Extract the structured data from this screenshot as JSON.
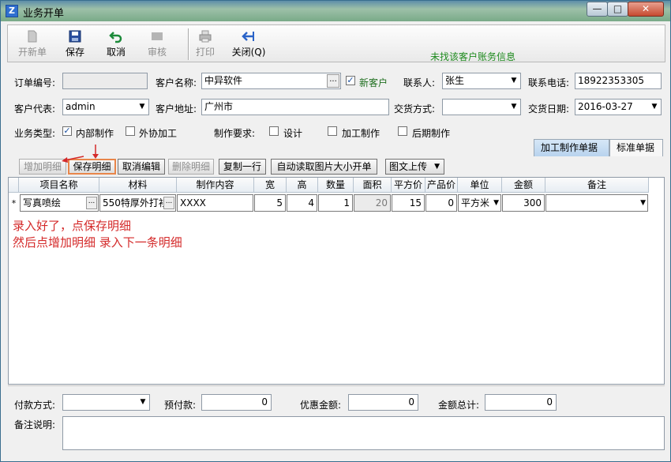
{
  "window": {
    "title": "业务开单",
    "min": "0",
    "max": "1",
    "close": "r"
  },
  "toolbar": {
    "new_label": "开新单",
    "save_label": "保存",
    "cancel_label": "取消",
    "audit_label": "审核",
    "print_label": "打印",
    "close_label": "关闭(Q)",
    "notice": "未找该客户账务信息"
  },
  "form": {
    "order_no_label": "订单编号:",
    "order_no_value": "",
    "customer_name_label": "客户名称:",
    "customer_name_value": "中异软件",
    "new_customer_label": "新客户",
    "contact_label": "联系人:",
    "contact_value": "张生",
    "phone_label": "联系电话:",
    "phone_value": "18922353305",
    "rep_label": "客户代表:",
    "rep_value": "admin",
    "address_label": "客户地址:",
    "address_value": "广州市",
    "delivery_label": "交货方式:",
    "delivery_value": "",
    "date_label": "交货日期:",
    "date_value": "2016-03-27",
    "biz_type_label": "业务类型:",
    "internal_label": "内部制作",
    "outsource_label": "外协加工",
    "req_label": "制作要求:",
    "design_label": "设计",
    "process_label": "加工制作",
    "post_label": "后期制作"
  },
  "tabs": {
    "processing": "加工制作单据",
    "standard": "标准单据"
  },
  "detail_buttons": {
    "add": "增加明细",
    "save": "保存明细",
    "cancel_edit": "取消编辑",
    "delete": "删除明细",
    "copy_row": "复制一行",
    "auto_read": "自动读取图片大小开单",
    "upload": "图文上传"
  },
  "grid": {
    "headers": [
      "项目名称",
      "材料",
      "制作内容",
      "宽",
      "高",
      "数量",
      "面积",
      "平方价",
      "产品价",
      "单位",
      "金额",
      "备注"
    ],
    "row_marker": "*",
    "row": [
      "写真喷绘",
      "550特厚外打衫",
      "XXXX",
      "5",
      "4",
      "1",
      "20",
      "15",
      "0",
      "平方米",
      "300",
      ""
    ]
  },
  "notes": {
    "line1": "录入好了，点保存明细",
    "line2": "然后点增加明细 录入下一条明细"
  },
  "footer": {
    "payment_label": "付款方式:",
    "payment_value": "",
    "prepay_label": "预付款:",
    "prepay_value": "0",
    "discount_label": "优惠金额:",
    "discount_value": "0",
    "total_label": "金额总计:",
    "total_value": "0",
    "remark_label": "备注说明:",
    "remark_value": ""
  },
  "icons": {
    "new": "new-doc-icon",
    "save": "floppy-disk-icon",
    "cancel": "undo-arrow-icon",
    "audit": "audit-stamp-icon",
    "print": "printer-icon",
    "close": "exit-arrow-icon"
  },
  "colors": {
    "notice": "#1e8a1e",
    "note": "#d42a2a",
    "highlight": "#e8864a"
  }
}
